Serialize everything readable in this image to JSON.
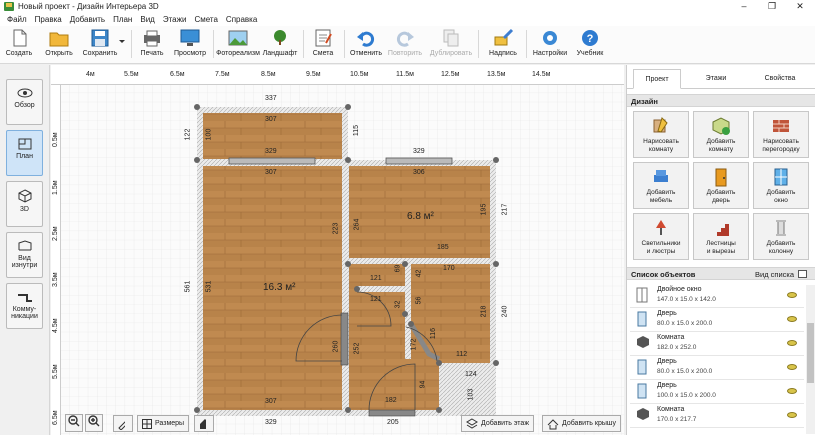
{
  "window": {
    "title": "Новый проект - Дизайн Интерьера 3D",
    "minimize": "–",
    "maximize": "❐",
    "close": "✕"
  },
  "menu": [
    "Файл",
    "Правка",
    "Добавить",
    "План",
    "Вид",
    "Этажи",
    "Смета",
    "Справка"
  ],
  "toolbar": {
    "create": "Создать",
    "open": "Открыть",
    "save": "Сохранить",
    "print": "Печать",
    "preview": "Просмотр",
    "photoreal": "Фотореализм",
    "landscape": "Ландшафт",
    "estimate": "Смета",
    "undo": "Отменить",
    "redo": "Повторить",
    "duplicate": "Дублировать",
    "labels": "Надпись",
    "settings": "Настройки",
    "tutorial": "Учебник"
  },
  "left": {
    "overview": "Обзор",
    "plan": "План",
    "view3d": "3D",
    "inside": "Вид\nизнутри",
    "comms": "Комму-\nникации"
  },
  "ruler": {
    "h": [
      "4м",
      "5.5м",
      "6.5м",
      "7.5м",
      "8.5м",
      "9.5м",
      "10.5м",
      "11.5м",
      "12.5м",
      "13.5м",
      "14.5м"
    ],
    "v": [
      "0.5м",
      "1.5м",
      "2.5м",
      "3.5м",
      "4.5м",
      "5.5м",
      "6.5м"
    ]
  },
  "plan": {
    "dims": {
      "top": "337",
      "tl_room_w": "307",
      "tl_room_w2": "329",
      "r_room_top": "329",
      "r_room_w": "306",
      "left_h": "561",
      "left_inner": "531",
      "tl_h": "122",
      "tl_h_inner": "100",
      "tl_right": "115",
      "right_h": "217",
      "right_inner": "195",
      "r_w": "185",
      "r_inner_h": "264",
      "r_inner_h2": "223",
      "small_w": "121",
      "small_w2": "121",
      "small_h": "69",
      "small_h2": "42",
      "small_h3": "32",
      "bath_w": "170",
      "bath_h": "218",
      "bath_h2": "240",
      "bath_w2": "112",
      "diag": "116",
      "diag2": "172",
      "door_h": "260",
      "door_h2": "252",
      "door_w": "182",
      "door_w2": "94",
      "bottom_inner": "307",
      "bottom": "329",
      "bottom_r": "205",
      "corner": "124",
      "corner2": "103",
      "corner3": "56"
    },
    "area_big": "16.3 м²",
    "area_right": "6.8 м²"
  },
  "canvas_buttons": {
    "sizes": "Размеры",
    "add_floor": "Добавить этаж",
    "add_roof": "Добавить крышу"
  },
  "right": {
    "tabs": [
      "Проект",
      "Этажи",
      "Свойства"
    ],
    "design_title": "Дизайн",
    "design_buttons": [
      "Нарисовать\nкомнату",
      "Добавить\nкомнату",
      "Нарисовать\nперегородку",
      "Добавить\nмебель",
      "Добавить\nдверь",
      "Добавить\nокно",
      "Светильники\nи люстры",
      "Лестницы\nи вырезы",
      "Добавить\nколонну"
    ],
    "objects_title": "Список объектов",
    "list_view": "Вид списка",
    "objects": [
      {
        "name": "Двойное окно",
        "size": "147.0 x 15.0 x 142.0"
      },
      {
        "name": "Дверь",
        "size": "80.0 x 15.0 x 200.0"
      },
      {
        "name": "Комната",
        "size": "182.0 x 252.0"
      },
      {
        "name": "Дверь",
        "size": "80.0 x 15.0 x 200.0"
      },
      {
        "name": "Дверь",
        "size": "100.0 x 15.0 x 200.0"
      },
      {
        "name": "Комната",
        "size": "170.0 x 217.7"
      }
    ]
  },
  "colors": {
    "floor": "#b8834a",
    "wall": "#e8e8e8",
    "accent": "#cfe4f8"
  }
}
